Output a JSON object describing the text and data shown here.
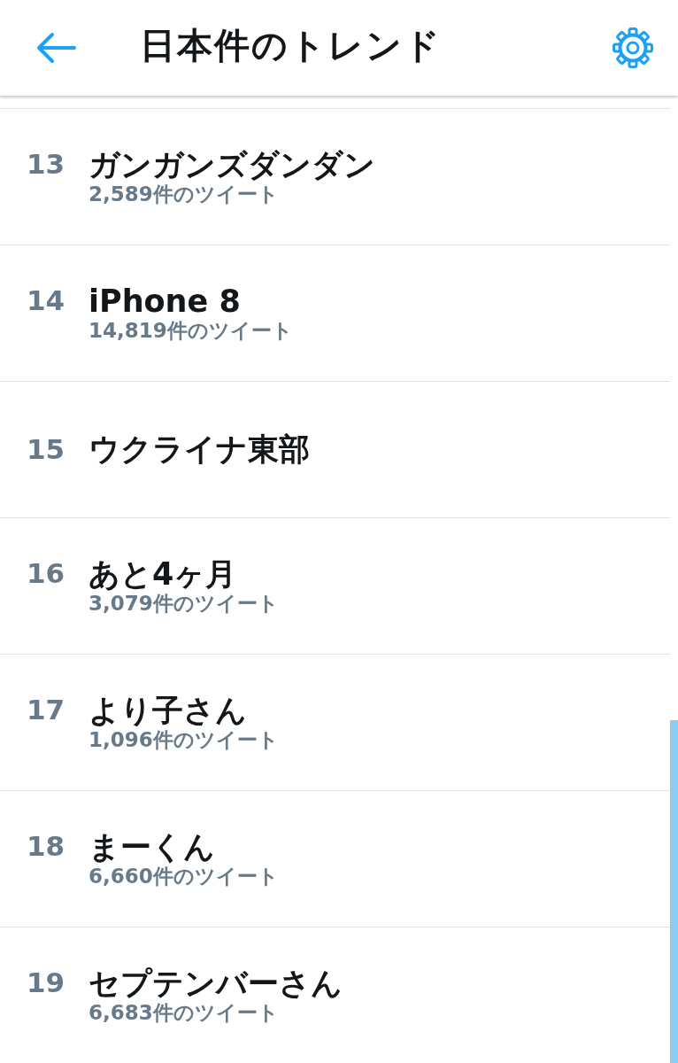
{
  "header": {
    "title": "日本件のトレンド"
  },
  "trends": [
    {
      "rank": "13",
      "name": "ガンガンズダンダン",
      "tweet_count": "2,589件のツイート"
    },
    {
      "rank": "14",
      "name": "iPhone 8",
      "tweet_count": "14,819件のツイート"
    },
    {
      "rank": "15",
      "name": "ウクライナ東部"
    },
    {
      "rank": "16",
      "name": "あと4ヶ月",
      "tweet_count": "3,079件のツイート"
    },
    {
      "rank": "17",
      "name": "より子さん",
      "tweet_count": "1,096件のツイート"
    },
    {
      "rank": "18",
      "name": "まーくん",
      "tweet_count": "6,660件のツイート"
    },
    {
      "rank": "19",
      "name": "セプテンバーさん",
      "tweet_count": "6,683件のツイート"
    }
  ]
}
